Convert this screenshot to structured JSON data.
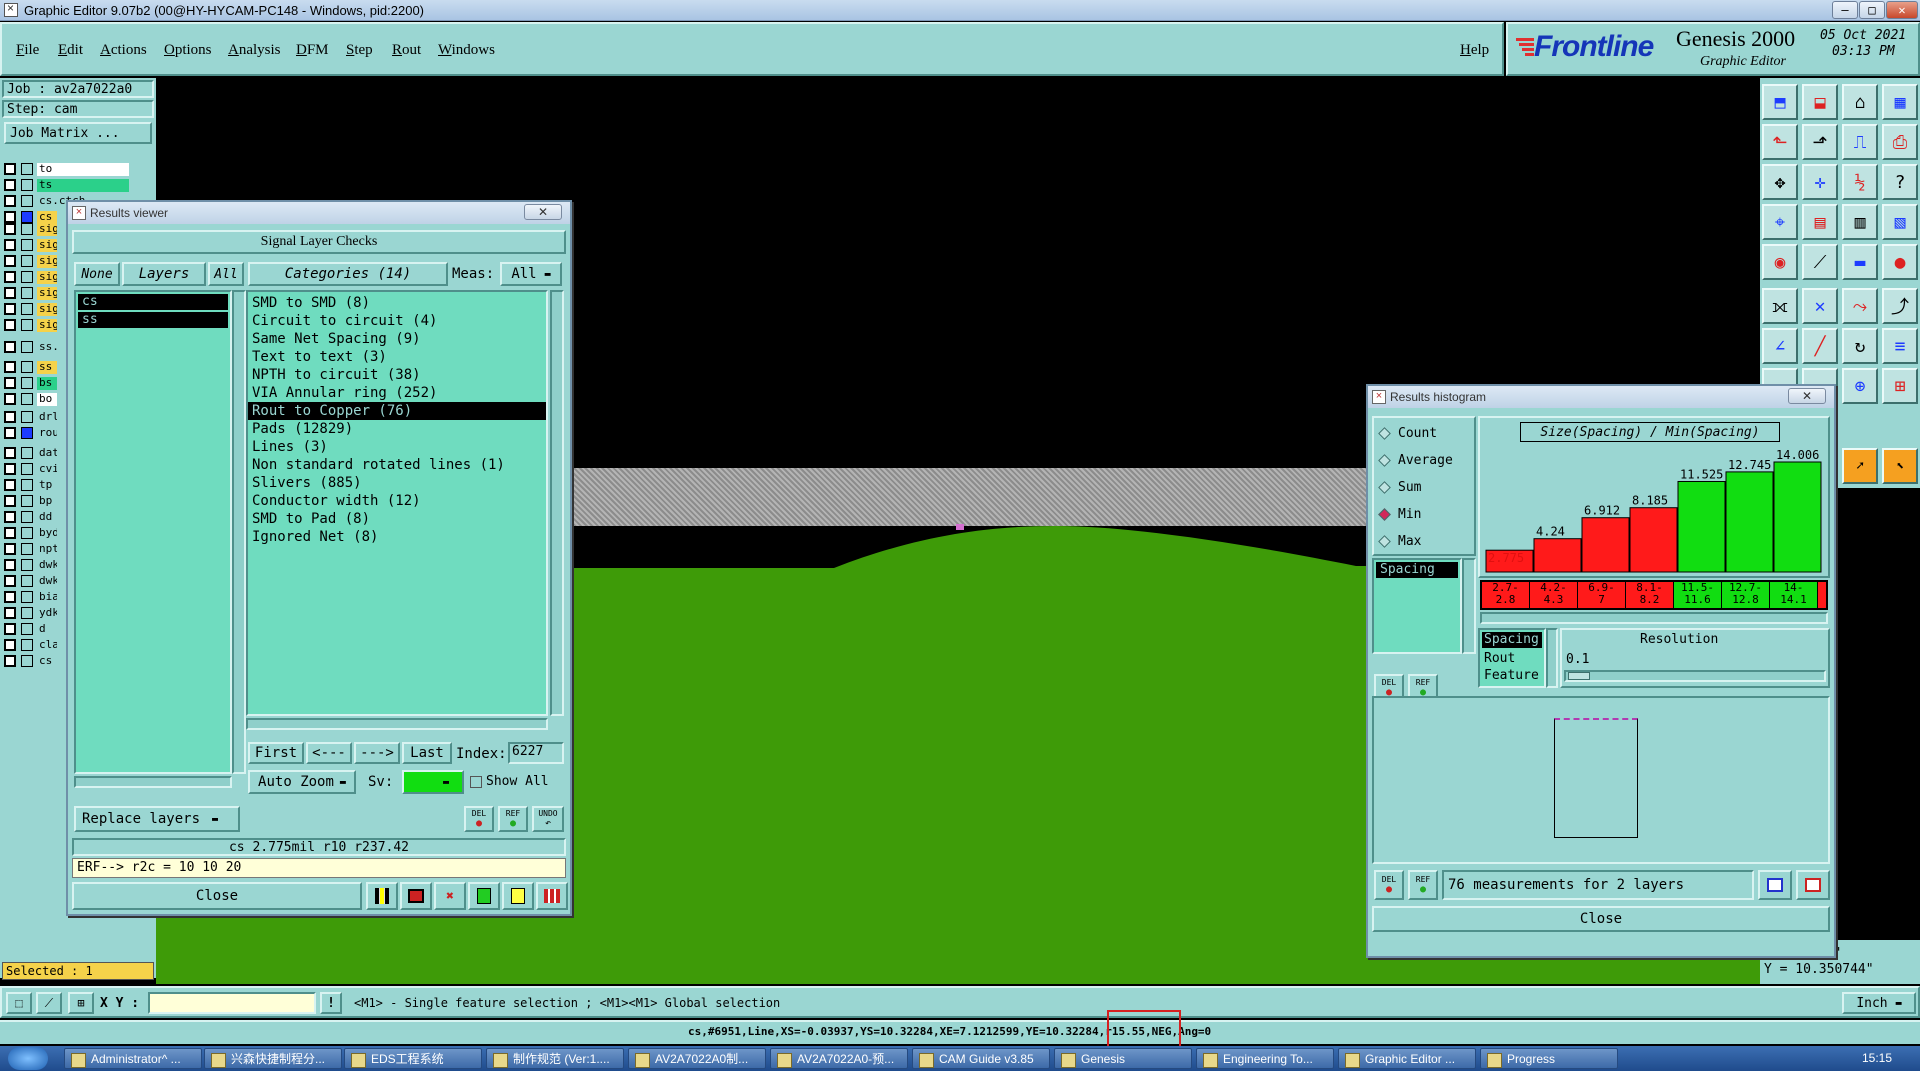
{
  "window": {
    "title": "Graphic Editor 9.07b2 (00@HY-HYCAM-PC148 - Windows, pid:2200)"
  },
  "menu": [
    "File",
    "Edit",
    "Actions",
    "Options",
    "Analysis",
    "DFM",
    "Step",
    "Rout",
    "Windows"
  ],
  "help": "Help",
  "brand": {
    "logo": "Frontline",
    "product": "Genesis 2000",
    "subtitle": "Graphic Editor",
    "date": "05 Oct 2021",
    "time": "03:13 PM"
  },
  "job": {
    "job_label": "Job : av2a7022a0",
    "step_label": "Step: cam",
    "matrix_button": "Job Matrix ..."
  },
  "layers": [
    "to",
    "ts",
    "cs.ctch",
    "cs",
    "sig",
    "sig",
    "sig",
    "sig",
    "sig",
    "sig",
    "sig",
    "ss.",
    "ss",
    "bs",
    "bo",
    "drl",
    "rou",
    "dat",
    "cvi",
    "tp",
    "bp",
    "dd",
    "byd",
    "npt",
    "dwk",
    "dwk",
    "bia",
    "ydk",
    "d",
    "cla",
    "cs"
  ],
  "selected_label": "Selected : 1",
  "results_viewer": {
    "title": "Results viewer",
    "header": "Signal Layer Checks",
    "none_btn": "None",
    "layers_btn": "Layers",
    "all_btn": "All",
    "categories_header": "Categories (14)",
    "meas_label": "Meas:",
    "meas_value": "All",
    "layer_list": [
      "cs",
      "ss"
    ],
    "categories": [
      "SMD to SMD (8)",
      "Circuit to circuit (4)",
      "Same Net Spacing (9)",
      "Text to text (3)",
      "NPTH to circuit (38)",
      "VIA Annular ring (252)",
      "Rout to Copper (76)",
      "Pads (12829)",
      "Lines (3)",
      "Non standard rotated lines (1)",
      "Slivers (885)",
      "Conductor width (12)",
      "SMD to Pad (8)",
      "Ignored Net (8)"
    ],
    "selected_category": "Rout to Copper (76)",
    "first_btn": "First",
    "prev_btn": "<---",
    "next_btn": "--->",
    "last_btn": "Last",
    "index_label": "Index:",
    "index_value": "6227",
    "autozoom": "Auto Zoom",
    "sv_label": "Sv:",
    "show_all": "Show All",
    "replace_layers": "Replace layers",
    "measure_line": "cs 2.775mil  r10  r237.42",
    "erf_line": "ERF--> r2c = 10 10 20",
    "close": "Close",
    "del": "DEL",
    "ref": "REF",
    "undo": "UNDO"
  },
  "histogram": {
    "title": "Results histogram",
    "options": [
      "Count",
      "Average",
      "Sum",
      "Min",
      "Max"
    ],
    "selected_option": "Min",
    "chart_title": "Size(Spacing) / Min(Spacing)",
    "list_left": [
      "Spacing"
    ],
    "list_bottom": [
      "Spacing",
      "Rout",
      "Feature"
    ],
    "resolution_label": "Resolution",
    "resolution_value": "0.1",
    "summary": "76 measurements for 2 layers",
    "close": "Close",
    "del": "DEL",
    "ref": "REF"
  },
  "chart_data": {
    "type": "bar",
    "title": "Size(Spacing) / Min(Spacing)",
    "categories": [
      "2.7-2.8",
      "4.2-4.3",
      "6.9-7",
      "8.1-8.2",
      "11.5-11.6",
      "12.7-12.8",
      "14-14.1"
    ],
    "category_labels": [
      "2.7-\n2.8",
      "4.2-\n4.3",
      "6.9-\n7",
      "8.1-\n8.2",
      "11.5-\n11.6",
      "12.7-\n12.8",
      "14-\n14.1"
    ],
    "values": [
      2.775,
      4.24,
      6.912,
      8.185,
      11.525,
      12.745,
      14.006
    ],
    "value_labels": [
      "2.775",
      "4.24",
      "6.912",
      "8.185",
      "11.525",
      "12.745",
      "14.006"
    ],
    "bar_colors": [
      "#ff1a1a",
      "#ff1a1a",
      "#ff1a1a",
      "#ff1a1a",
      "#11dd11",
      "#11dd11",
      "#11dd11"
    ],
    "ylim": [
      0,
      14.006
    ]
  },
  "coords": {
    "x_partial": "742\"",
    "y": "Y = 10.350744\""
  },
  "cmd": {
    "xy_label": "X Y :",
    "hint": "<M1> - Single feature selection ; <M1><M1> Global selection",
    "units": "Inch"
  },
  "info_line": "cs,#6951,Line,XS=-0.03937,YS=10.32284,XE=7.1212599,YE=10.32284,r15.55,NEG,Ang=0",
  "taskbar": {
    "items": [
      "Administrator^ ...",
      "兴森快捷制程分...",
      "EDS工程系统",
      "制作规范 (Ver:1....",
      "AV2A7022A0制...",
      "AV2A7022A0-预...",
      "CAM Guide v3.85",
      "Genesis",
      "Engineering To...",
      "Graphic Editor ...",
      "Progress"
    ],
    "clock": "15:15"
  },
  "colors": {
    "teal": "#9ad6d2",
    "mint": "#6fdcbf",
    "board_green": "#3e9b08",
    "bar_red": "#ff1a1a",
    "bar_green": "#11dd11",
    "highlight_box": "#d62020"
  }
}
